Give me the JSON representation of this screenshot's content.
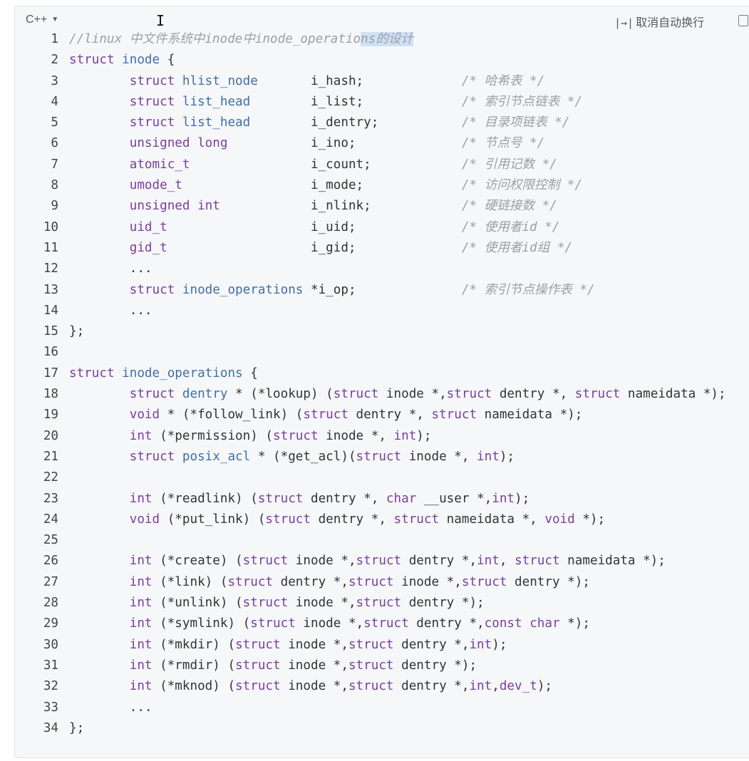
{
  "toolbar": {
    "language": "C++",
    "wrap_label": "取消自动换行",
    "wrap_icon": "|→|"
  },
  "lines": [
    {
      "n": "1",
      "segs": [
        [
          "cm",
          "//linux 中文件系统中inode中inode_operatio"
        ],
        [
          "cm sel",
          "ns的设计"
        ]
      ]
    },
    {
      "n": "2",
      "segs": [
        [
          "kw",
          "struct"
        ],
        [
          "",
          " "
        ],
        [
          "ty",
          "inode"
        ],
        [
          "",
          " {"
        ]
      ]
    },
    {
      "n": "3",
      "segs": [
        [
          "",
          "        "
        ],
        [
          "kw",
          "struct"
        ],
        [
          "",
          " "
        ],
        [
          "ty",
          "hlist_node"
        ],
        [
          "",
          "       i_hash;             "
        ],
        [
          "cm",
          "/* 哈希表 */"
        ]
      ]
    },
    {
      "n": "4",
      "segs": [
        [
          "",
          "        "
        ],
        [
          "kw",
          "struct"
        ],
        [
          "",
          " "
        ],
        [
          "ty",
          "list_head"
        ],
        [
          "",
          "        i_list;             "
        ],
        [
          "cm",
          "/* 索引节点链表 */"
        ]
      ]
    },
    {
      "n": "5",
      "segs": [
        [
          "",
          "        "
        ],
        [
          "kw",
          "struct"
        ],
        [
          "",
          " "
        ],
        [
          "ty",
          "list_head"
        ],
        [
          "",
          "        i_dentry;           "
        ],
        [
          "cm",
          "/* 目录项链表 */"
        ]
      ]
    },
    {
      "n": "6",
      "segs": [
        [
          "",
          "        "
        ],
        [
          "kw",
          "unsigned long"
        ],
        [
          "",
          "           i_ino;              "
        ],
        [
          "cm",
          "/* 节点号 */"
        ]
      ]
    },
    {
      "n": "7",
      "segs": [
        [
          "",
          "        "
        ],
        [
          "kw",
          "atomic_t"
        ],
        [
          "",
          "                i_count;            "
        ],
        [
          "cm",
          "/* 引用记数 */"
        ]
      ]
    },
    {
      "n": "8",
      "segs": [
        [
          "",
          "        "
        ],
        [
          "kw",
          "umode_t"
        ],
        [
          "",
          "                 i_mode;             "
        ],
        [
          "cm",
          "/* 访问权限控制 */"
        ]
      ]
    },
    {
      "n": "9",
      "segs": [
        [
          "",
          "        "
        ],
        [
          "kw",
          "unsigned int"
        ],
        [
          "",
          "            i_nlink;            "
        ],
        [
          "cm",
          "/* 硬链接数 */"
        ]
      ]
    },
    {
      "n": "10",
      "segs": [
        [
          "",
          "        "
        ],
        [
          "kw",
          "uid_t"
        ],
        [
          "",
          "                   i_uid;              "
        ],
        [
          "cm",
          "/* 使用者id */"
        ]
      ]
    },
    {
      "n": "11",
      "segs": [
        [
          "",
          "        "
        ],
        [
          "kw",
          "gid_t"
        ],
        [
          "",
          "                   i_gid;              "
        ],
        [
          "cm",
          "/* 使用者id组 */"
        ]
      ]
    },
    {
      "n": "12",
      "segs": [
        [
          "",
          "        ..."
        ]
      ]
    },
    {
      "n": "13",
      "segs": [
        [
          "",
          "        "
        ],
        [
          "kw",
          "struct"
        ],
        [
          "",
          " "
        ],
        [
          "ty",
          "inode_operations"
        ],
        [
          "",
          " *i_op;              "
        ],
        [
          "cm",
          "/* 索引节点操作表 */"
        ]
      ]
    },
    {
      "n": "14",
      "segs": [
        [
          "",
          "        ..."
        ]
      ]
    },
    {
      "n": "15",
      "segs": [
        [
          "",
          "};"
        ]
      ]
    },
    {
      "n": "16",
      "segs": [
        [
          "",
          ""
        ]
      ]
    },
    {
      "n": "17",
      "segs": [
        [
          "kw",
          "struct"
        ],
        [
          "",
          " "
        ],
        [
          "ty",
          "inode_operations"
        ],
        [
          "",
          " {"
        ]
      ]
    },
    {
      "n": "18",
      "segs": [
        [
          "",
          "        "
        ],
        [
          "kw",
          "struct"
        ],
        [
          "",
          " "
        ],
        [
          "ty",
          "dentry"
        ],
        [
          "",
          " * (*lookup) ("
        ],
        [
          "kw",
          "struct"
        ],
        [
          "",
          " inode *,"
        ],
        [
          "kw",
          "struct"
        ],
        [
          "",
          " dentry *, "
        ],
        [
          "kw",
          "struct"
        ],
        [
          "",
          " nameidata *);"
        ]
      ]
    },
    {
      "n": "19",
      "segs": [
        [
          "",
          "        "
        ],
        [
          "kw",
          "void"
        ],
        [
          "",
          " * (*follow_link) ("
        ],
        [
          "kw",
          "struct"
        ],
        [
          "",
          " dentry *, "
        ],
        [
          "kw",
          "struct"
        ],
        [
          "",
          " nameidata *);"
        ]
      ]
    },
    {
      "n": "20",
      "segs": [
        [
          "",
          "        "
        ],
        [
          "kw",
          "int"
        ],
        [
          "",
          " (*permission) ("
        ],
        [
          "kw",
          "struct"
        ],
        [
          "",
          " inode *, "
        ],
        [
          "kw",
          "int"
        ],
        [
          "",
          ");"
        ]
      ]
    },
    {
      "n": "21",
      "segs": [
        [
          "",
          "        "
        ],
        [
          "kw",
          "struct"
        ],
        [
          "",
          " "
        ],
        [
          "ty",
          "posix_acl"
        ],
        [
          "",
          " * (*get_acl)("
        ],
        [
          "kw",
          "struct"
        ],
        [
          "",
          " inode *, "
        ],
        [
          "kw",
          "int"
        ],
        [
          "",
          ");"
        ]
      ]
    },
    {
      "n": "22",
      "segs": [
        [
          "",
          ""
        ]
      ]
    },
    {
      "n": "23",
      "segs": [
        [
          "",
          "        "
        ],
        [
          "kw",
          "int"
        ],
        [
          "",
          " (*readlink) ("
        ],
        [
          "kw",
          "struct"
        ],
        [
          "",
          " dentry *, "
        ],
        [
          "kw",
          "char"
        ],
        [
          "",
          " __user *,"
        ],
        [
          "kw",
          "int"
        ],
        [
          "",
          ");"
        ]
      ]
    },
    {
      "n": "24",
      "segs": [
        [
          "",
          "        "
        ],
        [
          "kw",
          "void"
        ],
        [
          "",
          " (*put_link) ("
        ],
        [
          "kw",
          "struct"
        ],
        [
          "",
          " dentry *, "
        ],
        [
          "kw",
          "struct"
        ],
        [
          "",
          " nameidata *, "
        ],
        [
          "kw",
          "void"
        ],
        [
          "",
          " *);"
        ]
      ]
    },
    {
      "n": "25",
      "segs": [
        [
          "",
          ""
        ]
      ]
    },
    {
      "n": "26",
      "segs": [
        [
          "",
          "        "
        ],
        [
          "kw",
          "int"
        ],
        [
          "",
          " (*create) ("
        ],
        [
          "kw",
          "struct"
        ],
        [
          "",
          " inode *,"
        ],
        [
          "kw",
          "struct"
        ],
        [
          "",
          " dentry *,"
        ],
        [
          "kw",
          "int"
        ],
        [
          "",
          ", "
        ],
        [
          "kw",
          "struct"
        ],
        [
          "",
          " nameidata *);"
        ]
      ]
    },
    {
      "n": "27",
      "segs": [
        [
          "",
          "        "
        ],
        [
          "kw",
          "int"
        ],
        [
          "",
          " (*link) ("
        ],
        [
          "kw",
          "struct"
        ],
        [
          "",
          " dentry *,"
        ],
        [
          "kw",
          "struct"
        ],
        [
          "",
          " inode *,"
        ],
        [
          "kw",
          "struct"
        ],
        [
          "",
          " dentry *);"
        ]
      ]
    },
    {
      "n": "28",
      "segs": [
        [
          "",
          "        "
        ],
        [
          "kw",
          "int"
        ],
        [
          "",
          " (*unlink) ("
        ],
        [
          "kw",
          "struct"
        ],
        [
          "",
          " inode *,"
        ],
        [
          "kw",
          "struct"
        ],
        [
          "",
          " dentry *);"
        ]
      ]
    },
    {
      "n": "29",
      "segs": [
        [
          "",
          "        "
        ],
        [
          "kw",
          "int"
        ],
        [
          "",
          " (*symlink) ("
        ],
        [
          "kw",
          "struct"
        ],
        [
          "",
          " inode *,"
        ],
        [
          "kw",
          "struct"
        ],
        [
          "",
          " dentry *,"
        ],
        [
          "kw",
          "const char"
        ],
        [
          "",
          " *);"
        ]
      ]
    },
    {
      "n": "30",
      "segs": [
        [
          "",
          "        "
        ],
        [
          "kw",
          "int"
        ],
        [
          "",
          " (*mkdir) ("
        ],
        [
          "kw",
          "struct"
        ],
        [
          "",
          " inode *,"
        ],
        [
          "kw",
          "struct"
        ],
        [
          "",
          " dentry *,"
        ],
        [
          "kw",
          "int"
        ],
        [
          "",
          ");"
        ]
      ]
    },
    {
      "n": "31",
      "segs": [
        [
          "",
          "        "
        ],
        [
          "kw",
          "int"
        ],
        [
          "",
          " (*rmdir) ("
        ],
        [
          "kw",
          "struct"
        ],
        [
          "",
          " inode *,"
        ],
        [
          "kw",
          "struct"
        ],
        [
          "",
          " dentry *);"
        ]
      ]
    },
    {
      "n": "32",
      "segs": [
        [
          "",
          "        "
        ],
        [
          "kw",
          "int"
        ],
        [
          "",
          " (*mknod) ("
        ],
        [
          "kw",
          "struct"
        ],
        [
          "",
          " inode *,"
        ],
        [
          "kw",
          "struct"
        ],
        [
          "",
          " dentry *,"
        ],
        [
          "kw",
          "int"
        ],
        [
          "",
          ","
        ],
        [
          "kw",
          "dev_t"
        ],
        [
          "",
          ");"
        ]
      ]
    },
    {
      "n": "33",
      "segs": [
        [
          "",
          "        ..."
        ]
      ]
    },
    {
      "n": "34",
      "segs": [
        [
          "",
          "};"
        ]
      ]
    }
  ]
}
